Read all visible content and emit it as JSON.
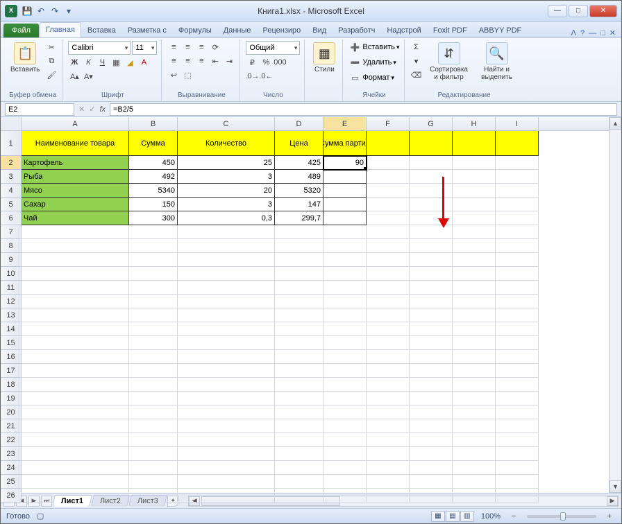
{
  "window": {
    "title": "Книга1.xlsx - Microsoft Excel"
  },
  "tabs": {
    "file": "Файл",
    "items": [
      "Главная",
      "Вставка",
      "Разметка с",
      "Формулы",
      "Данные",
      "Рецензиро",
      "Вид",
      "Разработч",
      "Надстрой",
      "Foxit PDF",
      "ABBYY PDF"
    ],
    "active": 0
  },
  "ribbon": {
    "clipboard": {
      "paste": "Вставить",
      "label": "Буфер обмена"
    },
    "font": {
      "name": "Calibri",
      "size": "11",
      "label": "Шрифт"
    },
    "align": {
      "label": "Выравнивание"
    },
    "number": {
      "format": "Общий",
      "label": "Число"
    },
    "styles": {
      "btn": "Стили"
    },
    "cells": {
      "insert": "Вставить",
      "delete": "Удалить",
      "format": "Формат",
      "label": "Ячейки"
    },
    "editing": {
      "sort": "Сортировка и фильтр",
      "find": "Найти и выделить",
      "label": "Редактирование"
    }
  },
  "formula_bar": {
    "name_box": "E2",
    "formula": "=B2/5"
  },
  "columns": [
    "A",
    "B",
    "C",
    "D",
    "E",
    "F",
    "G",
    "H",
    "I"
  ],
  "selected_col_index": 4,
  "selected_row_index": 1,
  "header_row": [
    "Наименование товара",
    "Сумма",
    "Количество",
    "Цена",
    "Сумма партии"
  ],
  "data_rows": [
    [
      "Картофель",
      "450",
      "25",
      "425",
      "90"
    ],
    [
      "Рыба",
      "492",
      "3",
      "489",
      ""
    ],
    [
      "Мясо",
      "5340",
      "20",
      "5320",
      ""
    ],
    [
      "Сахар",
      "150",
      "3",
      "147",
      ""
    ],
    [
      "Чай",
      "300",
      "0,3",
      "299,7",
      ""
    ]
  ],
  "chart_data": {
    "type": "table",
    "columns": [
      "Наименование товара",
      "Сумма",
      "Количество",
      "Цена",
      "Сумма партии"
    ],
    "rows": [
      [
        "Картофель",
        450,
        25,
        425,
        90
      ],
      [
        "Рыба",
        492,
        3,
        489,
        null
      ],
      [
        "Мясо",
        5340,
        20,
        5320,
        null
      ],
      [
        "Сахар",
        150,
        3,
        147,
        null
      ],
      [
        "Чай",
        300,
        0.3,
        299.7,
        null
      ]
    ]
  },
  "sheet_tabs": {
    "items": [
      "Лист1",
      "Лист2",
      "Лист3"
    ],
    "active": 0
  },
  "status": {
    "ready": "Готово",
    "zoom": "100%"
  }
}
